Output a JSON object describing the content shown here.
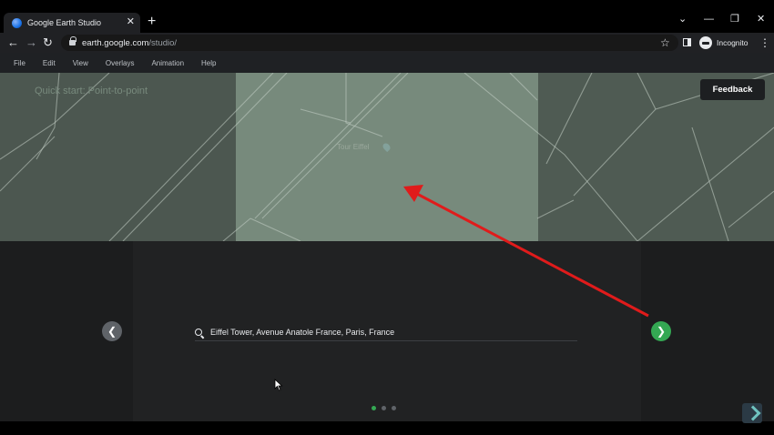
{
  "browser": {
    "tab_title": "Google Earth Studio",
    "tab_close": "✕",
    "new_tab": "+",
    "window_controls": [
      "⌄",
      "—",
      "❐",
      "✕"
    ],
    "url_host": "earth.google.com",
    "url_path": "/studio/",
    "incognito_label": "Incognito"
  },
  "menu": [
    "File",
    "Edit",
    "View",
    "Overlays",
    "Animation",
    "Help"
  ],
  "map": {
    "overlay_title": "Quick start: Point-to-point",
    "place_label": "Tour Eiffel",
    "feedback_label": "Feedback"
  },
  "search": {
    "value": "Eiffel Tower, Avenue Anatole France, Paris, France"
  },
  "pagination": {
    "total": 3,
    "active": 1
  },
  "colors": {
    "accent_green": "#34a853",
    "annotation_arrow": "#e01b1b"
  },
  "icons": {
    "prev": "chevron-left-icon",
    "next": "chevron-right-icon",
    "search": "search-icon"
  }
}
